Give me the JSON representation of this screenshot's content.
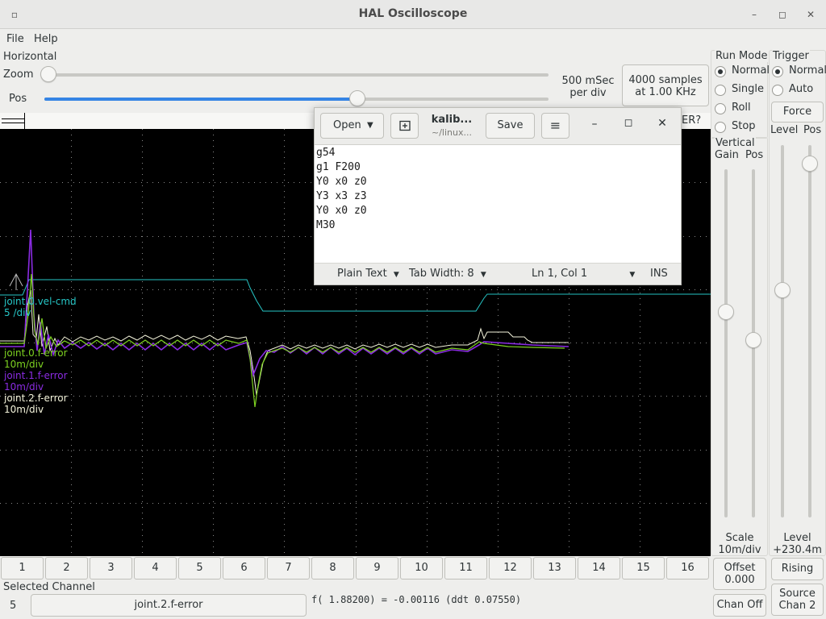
{
  "window": {
    "title": "HAL Oscilloscope",
    "menu_icon": "▫",
    "min_icon": "–",
    "max_icon": "◻",
    "close_icon": "✕"
  },
  "menu": [
    "File",
    "Help"
  ],
  "horizontal": {
    "label": "Horizontal",
    "zoom_label": "Zoom",
    "pos_label": "Pos",
    "zoom_level": 0.0,
    "pos_level": 0.62,
    "rate": "500 mSec\nper div",
    "samples": "4000 samples\nat 1.00 KHz",
    "trigger_status": "ER?"
  },
  "run_mode": {
    "label": "Run Mode",
    "options": [
      "Normal",
      "Single",
      "Roll",
      "Stop"
    ],
    "selected": 0
  },
  "trigger": {
    "label": "Trigger",
    "options": [
      "Normal",
      "Auto"
    ],
    "selected": 0,
    "force_label": "Force",
    "level_label": "Level",
    "pos_label": "Pos",
    "level_value": "Level\n+230.4m",
    "rising_label": "Rising",
    "source_label": "Source\nChan  2",
    "level_slider": 0.39,
    "pos_slider": 0.05
  },
  "vertical": {
    "label": "Vertical",
    "gain_label": "Gain",
    "pos_label": "Pos",
    "scale": "Scale\n10m/div",
    "offset_label": "Offset\n0.000",
    "chan_off_label": "Chan Off",
    "gain_slider": 0.41,
    "pos_slider": 0.49
  },
  "traces": [
    {
      "name": "joint.0.vel-cmd",
      "scale": "5 /div",
      "color": "#26c6c6"
    },
    {
      "name": "joint.0.f-error",
      "scale": "10m/div",
      "color": "#7ed321"
    },
    {
      "name": "joint.1.f-error",
      "scale": "10m/div",
      "color": "#8a2be2"
    },
    {
      "name": "joint.2.f-error",
      "scale": "10m/div",
      "color": "#f5f5dc"
    }
  ],
  "channels": [
    "1",
    "2",
    "3",
    "4",
    "5",
    "6",
    "7",
    "8",
    "9",
    "10",
    "11",
    "12",
    "13",
    "14",
    "15",
    "16"
  ],
  "selected_channel": {
    "label": "Selected Channel",
    "number": "5",
    "name": "joint.2.f-error",
    "readout": "f( 1.88200) = -0.00116 (ddt  0.07550)"
  },
  "gedit": {
    "open_label": "Open",
    "save_label": "Save",
    "file_name": "kalib...",
    "file_path": "~/linux...",
    "lines": [
      "g54",
      "g1 F200",
      "Y0 x0 z0",
      "Y3 x3 z3",
      "Y0 x0 z0",
      "M30"
    ],
    "lang": "Plain Text",
    "tab_width": "Tab Width: 8",
    "position": "Ln 1, Col 1",
    "mode": "INS"
  }
}
